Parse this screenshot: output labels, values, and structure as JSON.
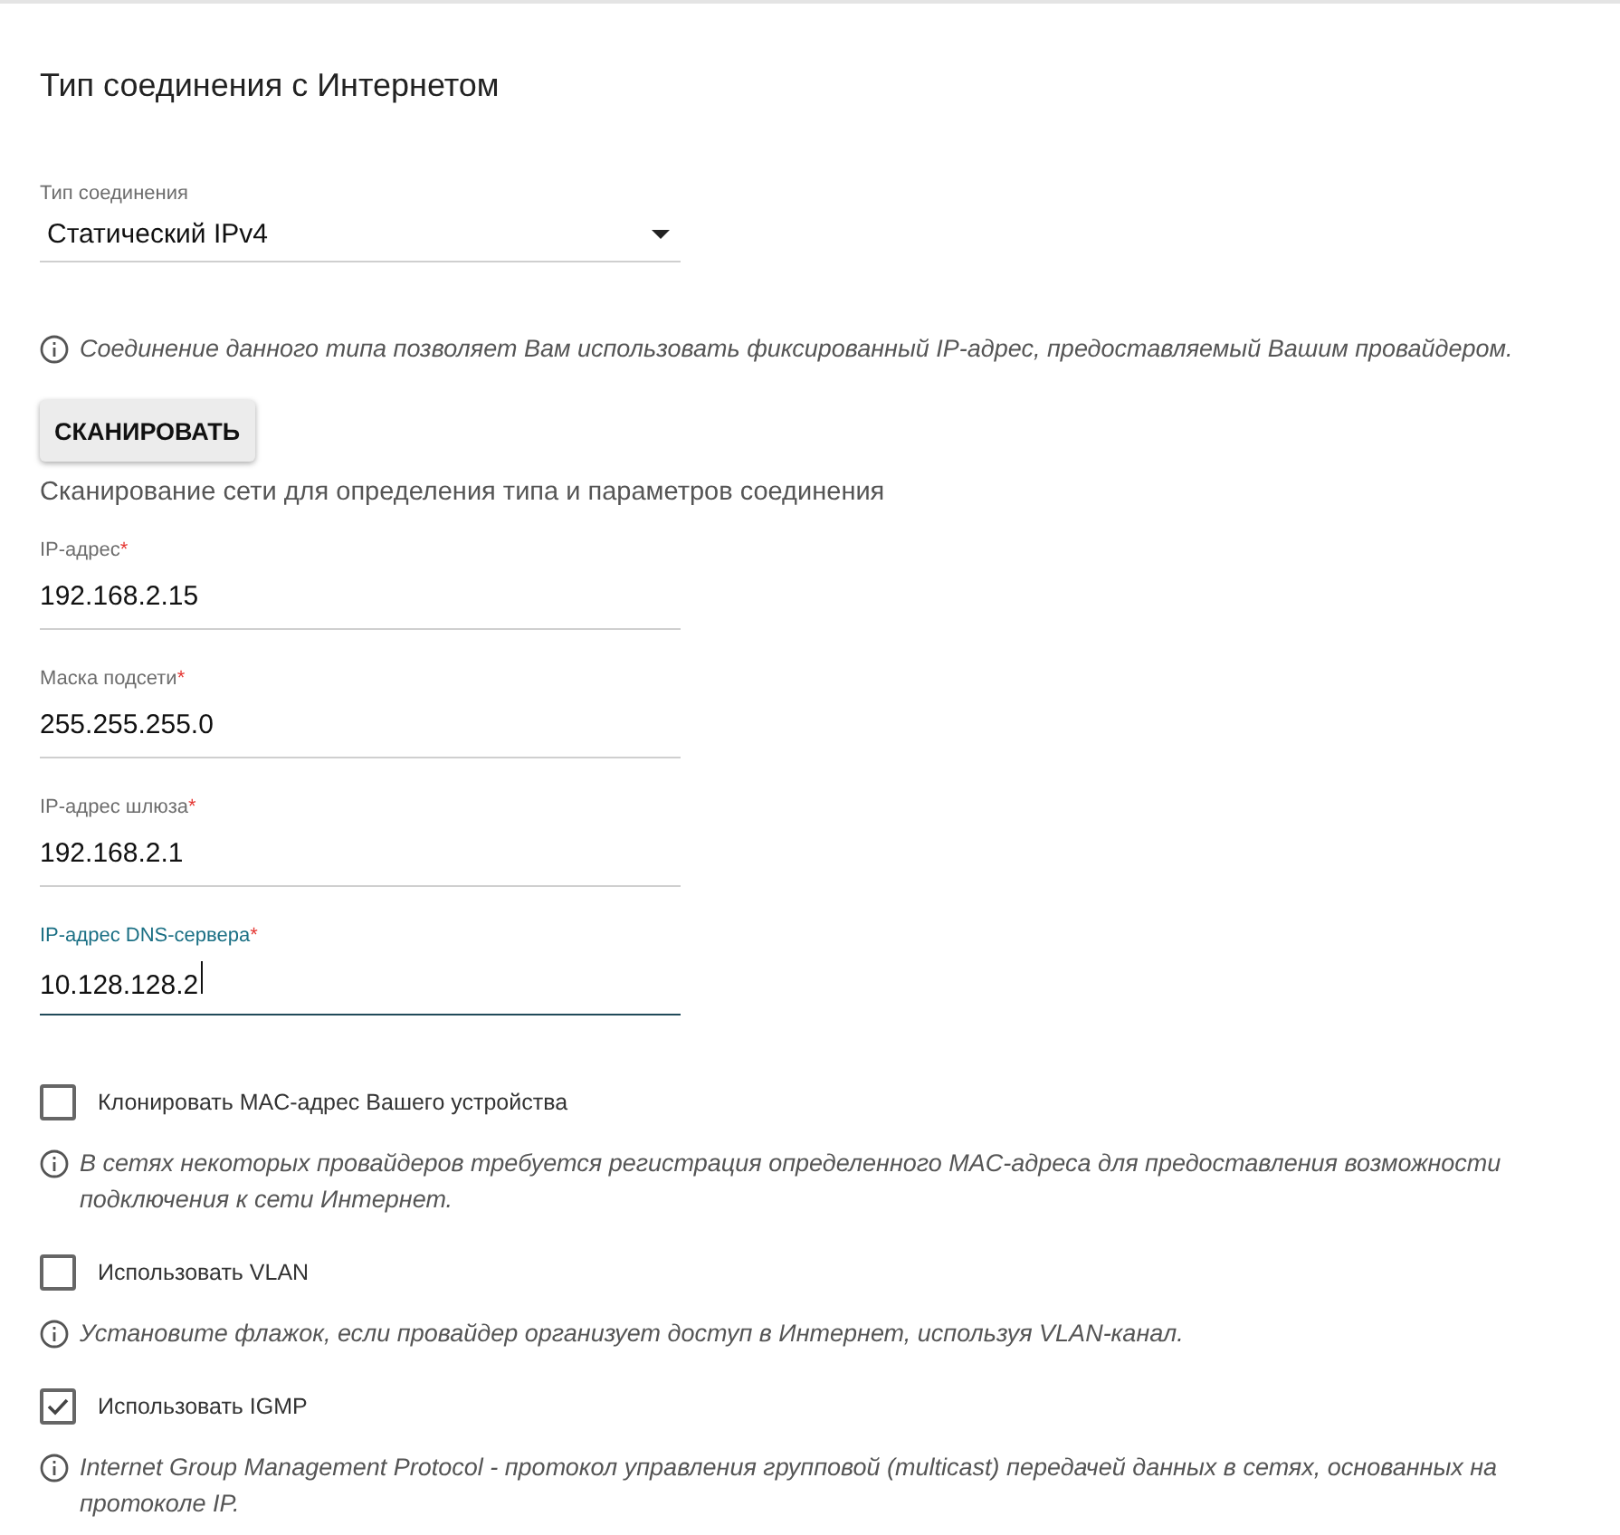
{
  "title": "Тип соединения с Интернетом",
  "connection_type": {
    "label": "Тип соединения",
    "value": "Статический IPv4"
  },
  "type_hint": "Соединение данного типа позволяет Вам использовать фиксированный IP-адрес, предоставляемый Вашим провайдером.",
  "scan_button": "СКАНИРОВАТЬ",
  "scan_note": "Сканирование сети для определения типа и параметров соединения",
  "fields": [
    {
      "label": "IP-адрес",
      "mark": "*",
      "value": "192.168.2.15",
      "focused": false
    },
    {
      "label": "Маска подсети",
      "mark": "*",
      "value": "255.255.255.0",
      "focused": false
    },
    {
      "label": "IP-адрес шлюза",
      "mark": "*",
      "value": "192.168.2.1",
      "focused": false
    },
    {
      "label": "IP-адрес DNS-сервера",
      "mark": "*",
      "value": "10.128.128.2",
      "focused": true
    }
  ],
  "options": [
    {
      "label": "Клонировать MAC-адрес Вашего устройства",
      "checked": false,
      "hint": "В сетях некоторых провайдеров требуется регистрация определенного MAC-адреса для предоставления возможности подключения к сети Интернет."
    },
    {
      "label": "Использовать VLAN",
      "checked": false,
      "hint": "Установите флажок, если провайдер организует доступ в Интернет, используя VLAN-канал."
    },
    {
      "label": "Использовать IGMP",
      "checked": true,
      "hint": "Internet Group Management Protocol - протокол управления групповой (multicast) передачей данных в сетях, основанных на протоколе IP."
    }
  ]
}
